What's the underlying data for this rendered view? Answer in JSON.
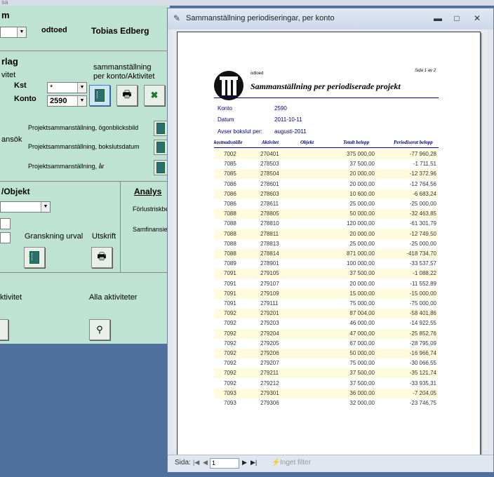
{
  "background_form": {
    "title_fragment": "sa",
    "header_label": "m",
    "combo_top_value": "",
    "user_code": "odtoed",
    "user_name": "Tobias Edberg",
    "section1_title": "rlag",
    "section1_sub": "vitet",
    "kst_label": "Kst",
    "kst_value": "*",
    "konto_label": "Konto",
    "konto_value": "2590",
    "summary_label_line1": "sammanställning",
    "summary_label_line2": "per konto/Aktivitet",
    "ansok_label": "ansök",
    "report_links": [
      "Projektsammanställning, ögonblicksbild",
      "Projektsammanställning, bokslutsdatum",
      "Projektsammanställning, år"
    ],
    "objekt_title": "/Objekt",
    "analys_title": "Analys",
    "forlust_label": "Förlustriskbe",
    "samfin_label": "Samfinansier",
    "granskning_label": "Granskning urval",
    "utskrift_label": "Utskrift",
    "aktivitet_label": "ktivitet",
    "alla_label": "Alla aktiviteter"
  },
  "window": {
    "title": "Sammanställning periodiseringar, per konto",
    "minimize": "▬",
    "maximize": "□",
    "close": "✕"
  },
  "status_bar": {
    "page_label": "Sida:",
    "page_value": "1",
    "first": "|◀",
    "prev": "◀",
    "next": "▶",
    "last": "▶|",
    "filter": "Inget filter"
  },
  "report": {
    "user_code": "odtoed",
    "page_info": "Sida 1 av 2",
    "title": "Sammanställning per periodiserade projekt",
    "konto_label": "Konto",
    "konto_value": "2590",
    "datum_label": "Datum",
    "datum_value": "2011-10-11",
    "avser_label": "Avser bokslut per:",
    "avser_value": "augusti-2011",
    "columns": [
      "kostnadsställe",
      "Aktivitet",
      "Objekt",
      "Totalt belopp",
      "Periodiserat belopp"
    ],
    "rows": [
      [
        "7002",
        "270401",
        "",
        "375 000,00",
        "-77 960,28"
      ],
      [
        "7085",
        "278503",
        "",
        "37 500,00",
        "-1 711,51"
      ],
      [
        "7085",
        "278504",
        "",
        "20 000,00",
        "-12 372,96"
      ],
      [
        "7086",
        "278601",
        "",
        "20 000,00",
        "-12 764,56"
      ],
      [
        "7086",
        "278603",
        "",
        "10 600,00",
        "-6 683,24"
      ],
      [
        "7086",
        "278611",
        "",
        "25 000,00",
        "-25 000,00"
      ],
      [
        "7088",
        "278805",
        "",
        "50 000,00",
        "-32 463,85"
      ],
      [
        "7088",
        "278810",
        "",
        "120 000,00",
        "-61 301,79"
      ],
      [
        "7088",
        "278811",
        "",
        "20 000,00",
        "-12 749,50"
      ],
      [
        "7088",
        "278813",
        "",
        "25 000,00",
        "-25 000,00"
      ],
      [
        "7088",
        "278814",
        "",
        "871 000,00",
        "-418 734,70"
      ],
      [
        "7089",
        "278901",
        "",
        "100 000,00",
        "-33 537,57"
      ],
      [
        "7091",
        "279105",
        "",
        "37 500,00",
        "-1 088,22"
      ],
      [
        "7091",
        "279107",
        "",
        "20 000,00",
        "-11 552,89"
      ],
      [
        "7091",
        "279109",
        "",
        "15 000,00",
        "-15 000,00"
      ],
      [
        "7091",
        "279111",
        "",
        "75 000,00",
        "-75 000,00"
      ],
      [
        "7092",
        "279201",
        "",
        "87 004,00",
        "-58 401,86"
      ],
      [
        "7092",
        "279203",
        "",
        "46 000,00",
        "-14 922,55"
      ],
      [
        "7092",
        "279204",
        "",
        "47 000,00",
        "-25 852,76"
      ],
      [
        "7092",
        "279205",
        "",
        "67 000,00",
        "-28 795,09"
      ],
      [
        "7092",
        "279206",
        "",
        "50 000,00",
        "-16 966,74"
      ],
      [
        "7092",
        "279207",
        "",
        "75 000,00",
        "-30 066,55"
      ],
      [
        "7092",
        "279211",
        "",
        "37 500,00",
        "-35 121,74"
      ],
      [
        "7092",
        "279212",
        "",
        "37 500,00",
        "-33 935,31"
      ],
      [
        "7093",
        "279301",
        "",
        "36 000,00",
        "-7 204,05"
      ],
      [
        "7093",
        "279306",
        "",
        "32 000,00",
        "-23 746,75"
      ]
    ]
  }
}
